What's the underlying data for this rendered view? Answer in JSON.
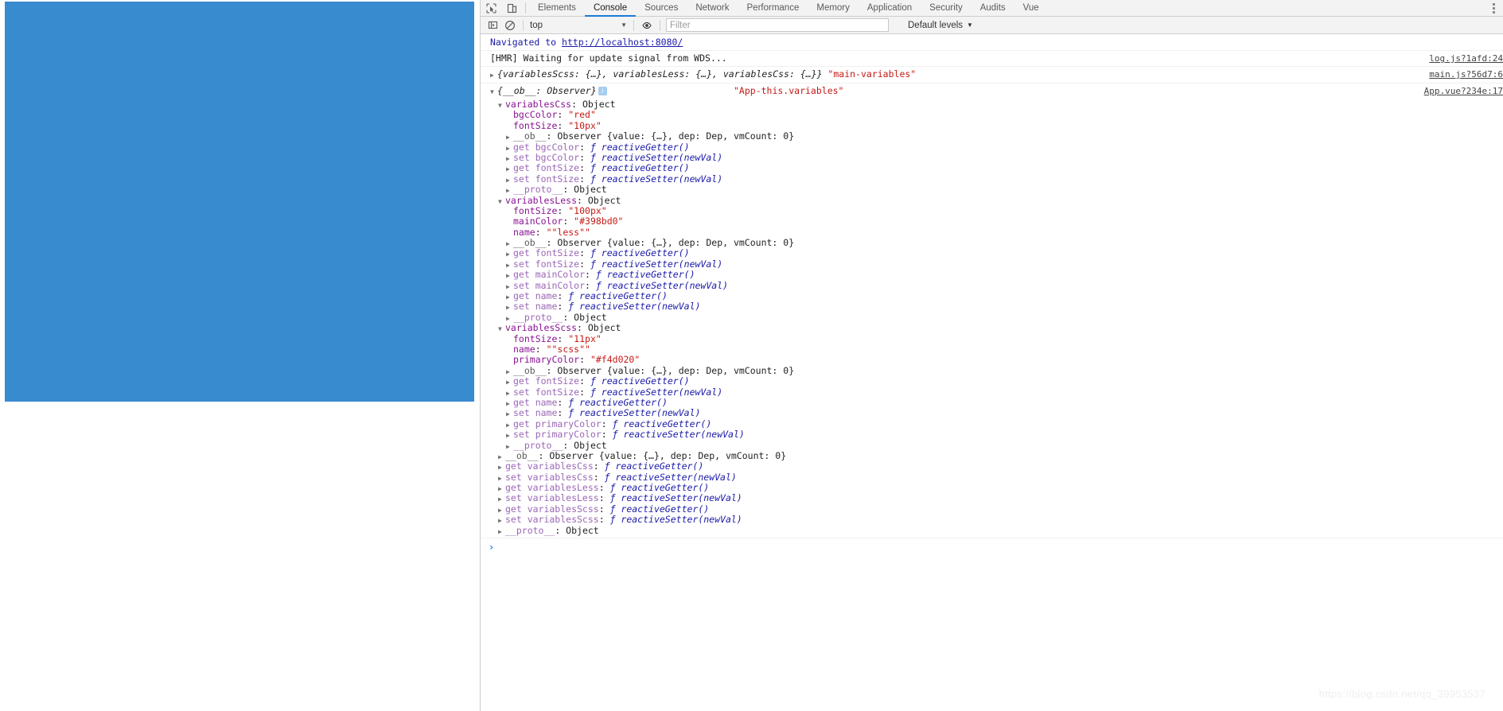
{
  "page": {
    "block_color": "#398bd0"
  },
  "devtools": {
    "toolbar_icons": {
      "inspect": "inspect-element-icon",
      "device": "device-toolbar-icon",
      "more": "more-options-icon"
    },
    "tabs": [
      {
        "label": "Elements",
        "active": false
      },
      {
        "label": "Console",
        "active": true
      },
      {
        "label": "Sources",
        "active": false
      },
      {
        "label": "Network",
        "active": false
      },
      {
        "label": "Performance",
        "active": false
      },
      {
        "label": "Memory",
        "active": false
      },
      {
        "label": "Application",
        "active": false
      },
      {
        "label": "Security",
        "active": false
      },
      {
        "label": "Audits",
        "active": false
      },
      {
        "label": "Vue",
        "active": false
      }
    ]
  },
  "console_toolbar": {
    "sidebar_icon": "console-sidebar-icon",
    "clear_icon": "clear-console-icon",
    "context": "top",
    "eye_icon": "live-expression-icon",
    "filter_placeholder": "Filter",
    "filter_value": "",
    "levels": "Default levels",
    "caret": "▼"
  },
  "messages": {
    "navigated": {
      "prefix": "Navigated to ",
      "url": "http://localhost:8080/"
    },
    "hmr": {
      "text": "[HMR] Waiting for update signal from WDS...",
      "source": "log.js?1afd:24"
    },
    "collapsed_obj": {
      "triangle": "▶",
      "text": "{variablesScss: {…}, variablesLess: {…}, variablesCss: {…}}",
      "tag": "\"main-variables\"",
      "source": "main.js?56d7:6"
    },
    "observer": {
      "triangle": "▼",
      "text": "{__ob__: Observer}",
      "badge": "i",
      "tag": "\"App-this.variables\"",
      "source": "App.vue?234e:17"
    }
  },
  "tree": [
    {
      "indent": 1,
      "tri": "▼",
      "key": "variablesCss",
      "keyClass": "k-name",
      "sep": ": ",
      "val": "Object",
      "valClass": "v-obj"
    },
    {
      "indent": 2,
      "tri": "",
      "key": "bgcColor",
      "keyClass": "k-name",
      "sep": ": ",
      "val": "\"red\"",
      "valClass": "v-str"
    },
    {
      "indent": 2,
      "tri": "",
      "key": "fontSize",
      "keyClass": "k-name",
      "sep": ": ",
      "val": "\"10px\"",
      "valClass": "v-str"
    },
    {
      "indent": 2,
      "tri": "▶",
      "key": "__ob__",
      "keyClass": "k-gray",
      "sep": ": ",
      "val": "Observer {value: {…}, dep: Dep, vmCount: 0}",
      "valClass": "v-obj"
    },
    {
      "indent": 2,
      "tri": "▶",
      "key": "get bgcColor",
      "keyClass": "k-proto",
      "sep": ": ",
      "val": "ƒ reactiveGetter()",
      "valClass": "fn-kw"
    },
    {
      "indent": 2,
      "tri": "▶",
      "key": "set bgcColor",
      "keyClass": "k-proto",
      "sep": ": ",
      "val": "ƒ reactiveSetter(newVal)",
      "valClass": "fn-kw"
    },
    {
      "indent": 2,
      "tri": "▶",
      "key": "get fontSize",
      "keyClass": "k-proto",
      "sep": ": ",
      "val": "ƒ reactiveGetter()",
      "valClass": "fn-kw"
    },
    {
      "indent": 2,
      "tri": "▶",
      "key": "set fontSize",
      "keyClass": "k-proto",
      "sep": ": ",
      "val": "ƒ reactiveSetter(newVal)",
      "valClass": "fn-kw"
    },
    {
      "indent": 2,
      "tri": "▶",
      "key": "__proto__",
      "keyClass": "k-proto",
      "sep": ": ",
      "val": "Object",
      "valClass": "v-obj"
    },
    {
      "indent": 1,
      "tri": "▼",
      "key": "variablesLess",
      "keyClass": "k-name",
      "sep": ": ",
      "val": "Object",
      "valClass": "v-obj"
    },
    {
      "indent": 2,
      "tri": "",
      "key": "fontSize",
      "keyClass": "k-name",
      "sep": ": ",
      "val": "\"100px\"",
      "valClass": "v-str"
    },
    {
      "indent": 2,
      "tri": "",
      "key": "mainColor",
      "keyClass": "k-name",
      "sep": ": ",
      "val": "\"#398bd0\"",
      "valClass": "v-str"
    },
    {
      "indent": 2,
      "tri": "",
      "key": "name",
      "keyClass": "k-name",
      "sep": ": ",
      "val": "\"\"less\"\"",
      "valClass": "v-str"
    },
    {
      "indent": 2,
      "tri": "▶",
      "key": "__ob__",
      "keyClass": "k-gray",
      "sep": ": ",
      "val": "Observer {value: {…}, dep: Dep, vmCount: 0}",
      "valClass": "v-obj"
    },
    {
      "indent": 2,
      "tri": "▶",
      "key": "get fontSize",
      "keyClass": "k-proto",
      "sep": ": ",
      "val": "ƒ reactiveGetter()",
      "valClass": "fn-kw"
    },
    {
      "indent": 2,
      "tri": "▶",
      "key": "set fontSize",
      "keyClass": "k-proto",
      "sep": ": ",
      "val": "ƒ reactiveSetter(newVal)",
      "valClass": "fn-kw"
    },
    {
      "indent": 2,
      "tri": "▶",
      "key": "get mainColor",
      "keyClass": "k-proto",
      "sep": ": ",
      "val": "ƒ reactiveGetter()",
      "valClass": "fn-kw"
    },
    {
      "indent": 2,
      "tri": "▶",
      "key": "set mainColor",
      "keyClass": "k-proto",
      "sep": ": ",
      "val": "ƒ reactiveSetter(newVal)",
      "valClass": "fn-kw"
    },
    {
      "indent": 2,
      "tri": "▶",
      "key": "get name",
      "keyClass": "k-proto",
      "sep": ": ",
      "val": "ƒ reactiveGetter()",
      "valClass": "fn-kw"
    },
    {
      "indent": 2,
      "tri": "▶",
      "key": "set name",
      "keyClass": "k-proto",
      "sep": ": ",
      "val": "ƒ reactiveSetter(newVal)",
      "valClass": "fn-kw"
    },
    {
      "indent": 2,
      "tri": "▶",
      "key": "__proto__",
      "keyClass": "k-proto",
      "sep": ": ",
      "val": "Object",
      "valClass": "v-obj"
    },
    {
      "indent": 1,
      "tri": "▼",
      "key": "variablesScss",
      "keyClass": "k-name",
      "sep": ": ",
      "val": "Object",
      "valClass": "v-obj"
    },
    {
      "indent": 2,
      "tri": "",
      "key": "fontSize",
      "keyClass": "k-name",
      "sep": ": ",
      "val": "\"11px\"",
      "valClass": "v-str"
    },
    {
      "indent": 2,
      "tri": "",
      "key": "name",
      "keyClass": "k-name",
      "sep": ": ",
      "val": "\"\"scss\"\"",
      "valClass": "v-str"
    },
    {
      "indent": 2,
      "tri": "",
      "key": "primaryColor",
      "keyClass": "k-name",
      "sep": ": ",
      "val": "\"#f4d020\"",
      "valClass": "v-str"
    },
    {
      "indent": 2,
      "tri": "▶",
      "key": "__ob__",
      "keyClass": "k-gray",
      "sep": ": ",
      "val": "Observer {value: {…}, dep: Dep, vmCount: 0}",
      "valClass": "v-obj"
    },
    {
      "indent": 2,
      "tri": "▶",
      "key": "get fontSize",
      "keyClass": "k-proto",
      "sep": ": ",
      "val": "ƒ reactiveGetter()",
      "valClass": "fn-kw"
    },
    {
      "indent": 2,
      "tri": "▶",
      "key": "set fontSize",
      "keyClass": "k-proto",
      "sep": ": ",
      "val": "ƒ reactiveSetter(newVal)",
      "valClass": "fn-kw"
    },
    {
      "indent": 2,
      "tri": "▶",
      "key": "get name",
      "keyClass": "k-proto",
      "sep": ": ",
      "val": "ƒ reactiveGetter()",
      "valClass": "fn-kw"
    },
    {
      "indent": 2,
      "tri": "▶",
      "key": "set name",
      "keyClass": "k-proto",
      "sep": ": ",
      "val": "ƒ reactiveSetter(newVal)",
      "valClass": "fn-kw"
    },
    {
      "indent": 2,
      "tri": "▶",
      "key": "get primaryColor",
      "keyClass": "k-proto",
      "sep": ": ",
      "val": "ƒ reactiveGetter()",
      "valClass": "fn-kw"
    },
    {
      "indent": 2,
      "tri": "▶",
      "key": "set primaryColor",
      "keyClass": "k-proto",
      "sep": ": ",
      "val": "ƒ reactiveSetter(newVal)",
      "valClass": "fn-kw"
    },
    {
      "indent": 2,
      "tri": "▶",
      "key": "__proto__",
      "keyClass": "k-proto",
      "sep": ": ",
      "val": "Object",
      "valClass": "v-obj"
    },
    {
      "indent": 1,
      "tri": "▶",
      "key": "__ob__",
      "keyClass": "k-gray",
      "sep": ": ",
      "val": "Observer {value: {…}, dep: Dep, vmCount: 0}",
      "valClass": "v-obj"
    },
    {
      "indent": 1,
      "tri": "▶",
      "key": "get variablesCss",
      "keyClass": "k-proto",
      "sep": ": ",
      "val": "ƒ reactiveGetter()",
      "valClass": "fn-kw"
    },
    {
      "indent": 1,
      "tri": "▶",
      "key": "set variablesCss",
      "keyClass": "k-proto",
      "sep": ": ",
      "val": "ƒ reactiveSetter(newVal)",
      "valClass": "fn-kw"
    },
    {
      "indent": 1,
      "tri": "▶",
      "key": "get variablesLess",
      "keyClass": "k-proto",
      "sep": ": ",
      "val": "ƒ reactiveGetter()",
      "valClass": "fn-kw"
    },
    {
      "indent": 1,
      "tri": "▶",
      "key": "set variablesLess",
      "keyClass": "k-proto",
      "sep": ": ",
      "val": "ƒ reactiveSetter(newVal)",
      "valClass": "fn-kw"
    },
    {
      "indent": 1,
      "tri": "▶",
      "key": "get variablesScss",
      "keyClass": "k-proto",
      "sep": ": ",
      "val": "ƒ reactiveGetter()",
      "valClass": "fn-kw"
    },
    {
      "indent": 1,
      "tri": "▶",
      "key": "set variablesScss",
      "keyClass": "k-proto",
      "sep": ": ",
      "val": "ƒ reactiveSetter(newVal)",
      "valClass": "fn-kw"
    },
    {
      "indent": 1,
      "tri": "▶",
      "key": "__proto__",
      "keyClass": "k-proto",
      "sep": ": ",
      "val": "Object",
      "valClass": "v-obj"
    }
  ],
  "prompt": {
    "symbol": "›"
  },
  "watermark": "https://blog.csdn.net/qq_39953537"
}
